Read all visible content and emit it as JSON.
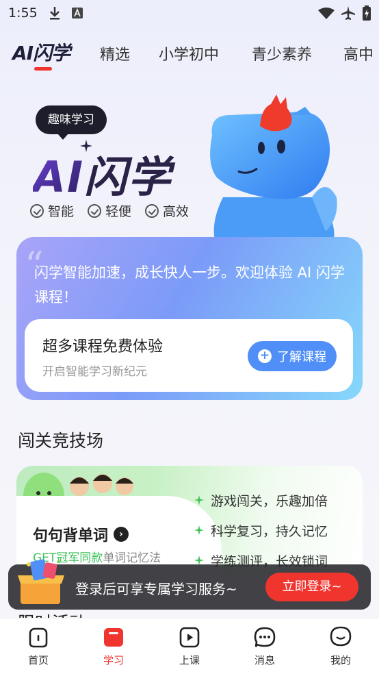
{
  "status_bar": {
    "time": "1:55"
  },
  "tabs": [
    {
      "label": "AI闪学",
      "active": true
    },
    {
      "label": "精选"
    },
    {
      "label": "小学初中"
    },
    {
      "label": "青少素养"
    },
    {
      "label": "高中"
    }
  ],
  "hero": {
    "tag": "趣味学习",
    "title_ai": "AI",
    "title_rest": "闪学",
    "features": [
      "智能",
      "轻便",
      "高效"
    ]
  },
  "intro_card": {
    "text": "闪学智能加速，成长快人一步。欢迎体验 AI 闪学课程！",
    "inner_title": "超多课程免费体验",
    "inner_sub": "开启智能学习新纪元",
    "button": "了解课程"
  },
  "arena": {
    "section_title": "闯关竞技场",
    "card_title": "句句背单词",
    "sub_highlight": "GET冠军同款",
    "sub_rest": "单词记忆法",
    "bullets": [
      "游戏闯关，乐趣加倍",
      "科学复习，持久记忆",
      "学练测评，长效锁词"
    ]
  },
  "login_banner": {
    "text": "登录后可享专属学习服务~",
    "button": "立即登录~"
  },
  "next_section_title": "限时活动",
  "bottom_nav": [
    {
      "label": "首页",
      "icon": "home-icon"
    },
    {
      "label": "学习",
      "icon": "study-icon",
      "active": true
    },
    {
      "label": "上课",
      "icon": "play-icon"
    },
    {
      "label": "消息",
      "icon": "message-icon"
    },
    {
      "label": "我的",
      "icon": "profile-icon"
    }
  ],
  "colors": {
    "accent": "#f0352f",
    "blue": "#4f8ff7",
    "green": "#3ec25a"
  }
}
